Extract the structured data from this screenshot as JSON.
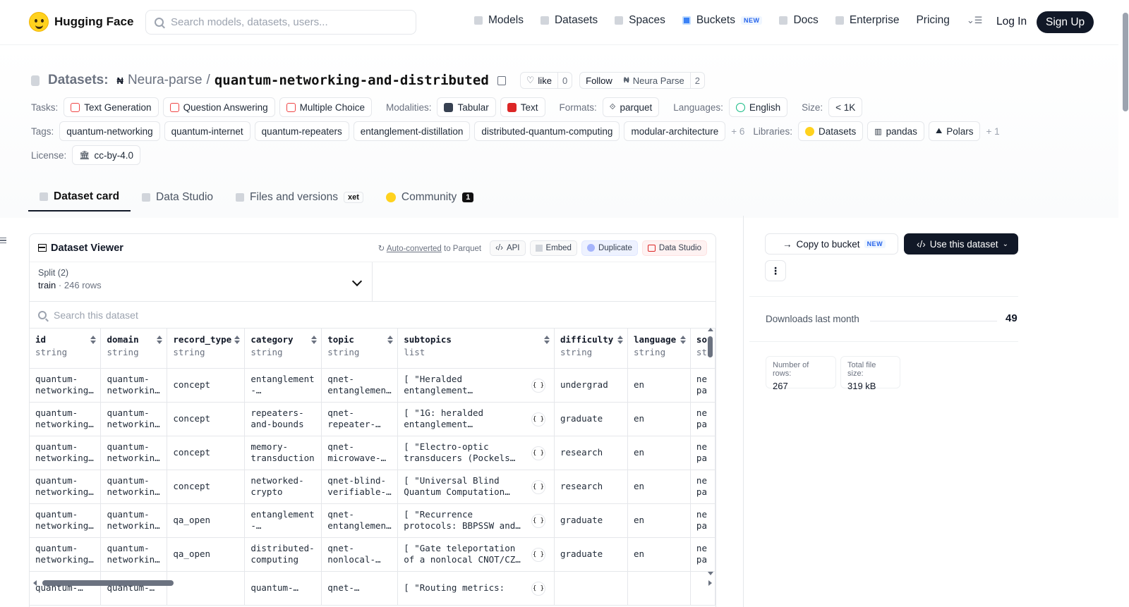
{
  "nav": {
    "brand": "Hugging Face",
    "search_placeholder": "Search models, datasets, users...",
    "links": [
      {
        "label": "Models",
        "icon": "cube-icon"
      },
      {
        "label": "Datasets",
        "icon": "database-icon"
      },
      {
        "label": "Spaces",
        "icon": "grid-icon"
      },
      {
        "label": "Buckets",
        "icon": "bucket-icon",
        "badge": "NEW"
      },
      {
        "label": "Docs",
        "icon": "book-icon"
      },
      {
        "label": "Enterprise",
        "icon": "enterprise-icon"
      },
      {
        "label": "Pricing"
      }
    ],
    "login": "Log In",
    "signup": "Sign Up"
  },
  "header": {
    "section": "Datasets:",
    "owner": "Neura-parse",
    "slash": "/",
    "repo": "quantum-networking-and-distributed",
    "like_label": "like",
    "like_count": "0",
    "follow_label": "Follow",
    "org_name": "Neura Parse",
    "follow_count": "2"
  },
  "meta": {
    "tasks_label": "Tasks:",
    "tasks": [
      "Text Generation",
      "Question Answering",
      "Multiple Choice"
    ],
    "modalities_label": "Modalities:",
    "modalities": [
      "Tabular",
      "Text"
    ],
    "formats_label": "Formats:",
    "formats": [
      "parquet"
    ],
    "languages_label": "Languages:",
    "languages": [
      "English"
    ],
    "size_label": "Size:",
    "size": "< 1K",
    "tags_label": "Tags:",
    "tags": [
      "quantum-networking",
      "quantum-internet",
      "quantum-repeaters",
      "entanglement-distillation",
      "distributed-quantum-computing",
      "modular-architecture"
    ],
    "tags_more": "+ 6",
    "libraries_label": "Libraries:",
    "libraries": [
      "Datasets",
      "pandas",
      "Polars"
    ],
    "libraries_more": "+ 1",
    "license_label": "License:",
    "license": "cc-by-4.0"
  },
  "tabs": [
    {
      "label": "Dataset card",
      "active": true
    },
    {
      "label": "Data Studio"
    },
    {
      "label": "Files and versions",
      "badge": "xet"
    },
    {
      "label": "Community",
      "badge": "1"
    }
  ],
  "viewer": {
    "title": "Dataset Viewer",
    "auto_converted": "Auto-converted",
    "to_parquet": "to Parquet",
    "api": "API",
    "embed": "Embed",
    "duplicate": "Duplicate",
    "data_studio": "Data Studio",
    "split_label": "Split (2)",
    "split_value": "train",
    "split_rows": "246 rows",
    "search_placeholder": "Search this dataset",
    "columns": [
      {
        "name": "id",
        "type": "string"
      },
      {
        "name": "domain",
        "type": "string"
      },
      {
        "name": "record_type",
        "type": "string"
      },
      {
        "name": "category",
        "type": "string"
      },
      {
        "name": "topic",
        "type": "string"
      },
      {
        "name": "subtopics",
        "type": "list"
      },
      {
        "name": "difficulty",
        "type": "string"
      },
      {
        "name": "language",
        "type": "string"
      },
      {
        "name": "so",
        "type": "st"
      }
    ],
    "rows": [
      [
        "quantum-networking-…",
        "quantum-networkin…",
        "concept",
        "entanglement-distribution",
        "qnet-entanglemen…",
        "[ \"Heralded entanglement generation: single-…",
        "undergrad",
        "en",
        "ne pa"
      ],
      [
        "quantum-networking-…",
        "quantum-networkin…",
        "concept",
        "repeaters-and-bounds",
        "qnet-repeater-…",
        "[ \"1G: heralded entanglement generation…",
        "graduate",
        "en",
        "ne pa"
      ],
      [
        "quantum-networking-…",
        "quantum-networkin…",
        "concept",
        "memory-transduction",
        "qnet-microwave-…",
        "[ \"Electro-optic transducers (Pockels…",
        "research",
        "en",
        "ne pa"
      ],
      [
        "quantum-networking-…",
        "quantum-networkin…",
        "concept",
        "networked-crypto",
        "qnet-blind-verifiable-…",
        "[ \"Universal Blind Quantum Computation…",
        "research",
        "en",
        "ne pa"
      ],
      [
        "quantum-networking-…",
        "quantum-networkin…",
        "qa_open",
        "entanglement-distribution",
        "qnet-entanglemen…",
        "[ \"Recurrence protocols: BBPSSW and DEJMPS\",…",
        "graduate",
        "en",
        "ne pa"
      ],
      [
        "quantum-networking-…",
        "quantum-networkin…",
        "qa_open",
        "distributed-computing",
        "qnet-nonlocal-…",
        "[ \"Gate teleportation of a nonlocal CNOT/CZ…",
        "graduate",
        "en",
        "ne pa"
      ],
      [
        "quantum-…",
        "quantum-…",
        "",
        "quantum-…",
        "qnet-…",
        "[ \"Routing metrics:",
        "",
        "",
        ""
      ]
    ]
  },
  "side": {
    "copy_bucket": "Copy to bucket",
    "copy_badge": "NEW",
    "use_dataset": "Use this dataset",
    "kebab": "⋮",
    "downloads_label": "Downloads last month",
    "downloads_value": "49",
    "rows_label": "Number of rows:",
    "rows_value": "267",
    "size_label": "Total file size:",
    "size_value": "319 kB"
  }
}
